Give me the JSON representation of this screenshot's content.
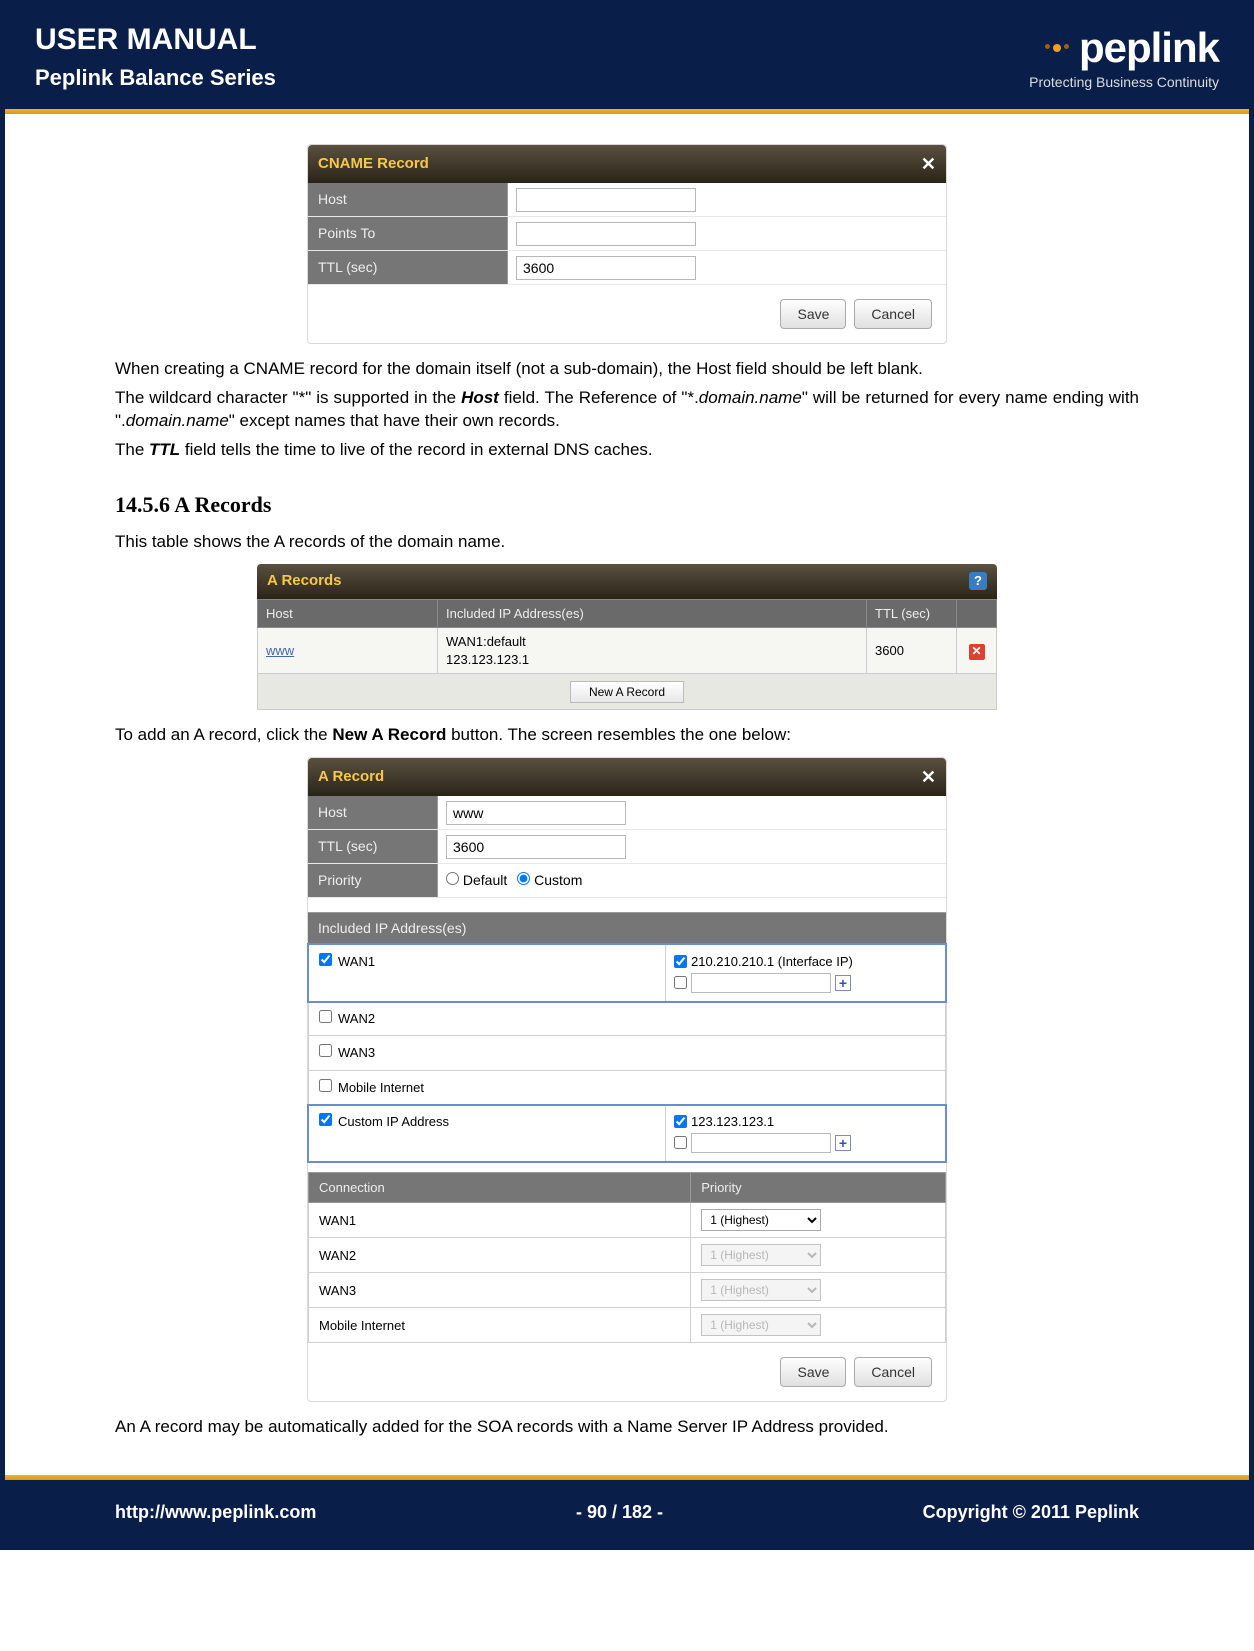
{
  "header": {
    "title": "USER MANUAL",
    "subtitle": "Peplink Balance Series",
    "logo_text": "peplink",
    "logo_tagline": "Protecting Business Continuity"
  },
  "cname_panel": {
    "title": "CNAME Record",
    "rows": {
      "host_label": "Host",
      "host_value": "",
      "points_label": "Points To",
      "points_value": "",
      "ttl_label": "TTL (sec)",
      "ttl_value": "3600"
    },
    "save_btn": "Save",
    "cancel_btn": "Cancel"
  },
  "para1": "When creating a CNAME record for the domain itself (not a sub-domain), the Host field should be left blank.",
  "para2_pre": "The wildcard character \"*\" is supported in the ",
  "para2_host": "Host",
  "para2_mid": " field.  The Reference of \"*.",
  "para2_dom1": "domain.name",
  "para2_mid2": "\" will be returned for every name ending with \".",
  "para2_dom2": "domain.name",
  "para2_end": "\" except names that have their own records.",
  "para3_pre": "The ",
  "para3_ttl": "TTL",
  "para3_end": " field tells the time to live of the record in external DNS caches.",
  "section_heading": "14.5.6 A Records",
  "para4": "This table shows the A records of the domain name.",
  "a_table": {
    "title": "A Records",
    "col_host": "Host",
    "col_ip": "Included IP Address(es)",
    "col_ttl": "TTL (sec)",
    "row1_host": "www",
    "row1_ip": "WAN1:default\n123.123.123.1",
    "row1_ttl": "3600",
    "new_btn": "New A Record"
  },
  "para5_pre": "To add an A record, click the ",
  "para5_bold": "New A Record",
  "para5_end": " button.  The screen resembles the one below:",
  "a_record_panel": {
    "title": "A Record",
    "host_label": "Host",
    "host_value": "www",
    "ttl_label": "TTL (sec)",
    "ttl_value": "3600",
    "priority_label": "Priority",
    "priority_opt1": "Default",
    "priority_opt2": "Custom",
    "included_header": "Included IP Address(es)",
    "wan1": "WAN1",
    "wan1_ip": "210.210.210.1 (Interface IP)",
    "wan2": "WAN2",
    "wan3": "WAN3",
    "mobile": "Mobile Internet",
    "custom": "Custom IP Address",
    "custom_ip": "123.123.123.1",
    "conn_header": "Connection",
    "prio_header": "Priority",
    "prio_val": "1 (Highest)",
    "save_btn": "Save",
    "cancel_btn": "Cancel",
    "rows": [
      "WAN1",
      "WAN2",
      "WAN3",
      "Mobile Internet"
    ]
  },
  "para6": "An A record may be automatically added for the SOA records with a Name Server IP Address provided.",
  "footer": {
    "url": "http://www.peplink.com",
    "page": "- 90 / 182 -",
    "copyright": "Copyright © 2011 Peplink"
  }
}
